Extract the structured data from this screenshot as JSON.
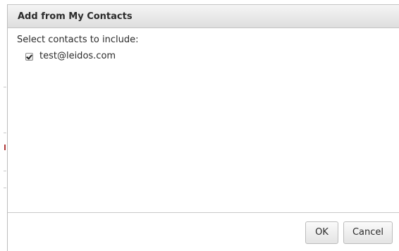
{
  "dialog": {
    "title": "Add from My Contacts",
    "instruction": "Select contacts to include:"
  },
  "contacts": [
    {
      "email": "test@leidos.com",
      "checked": true
    }
  ],
  "buttons": {
    "ok_label": "OK",
    "cancel_label": "Cancel"
  }
}
